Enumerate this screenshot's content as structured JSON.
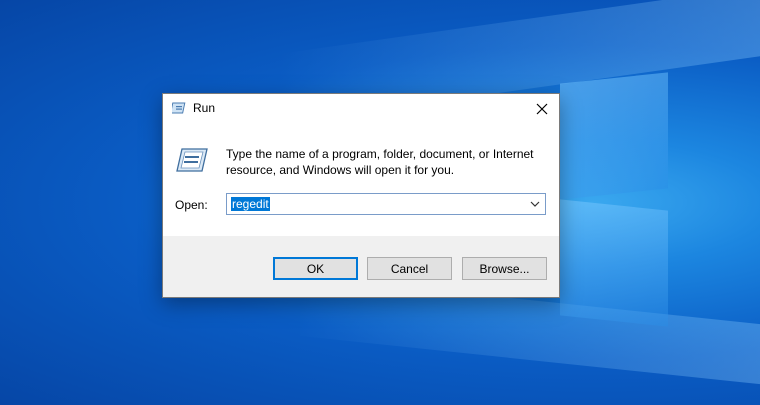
{
  "dialog": {
    "title": "Run",
    "description": "Type the name of a program, folder, document, or Internet resource, and Windows will open it for you.",
    "open_label": "Open:",
    "open_value": "regedit",
    "buttons": {
      "ok": "OK",
      "cancel": "Cancel",
      "browse": "Browse..."
    }
  },
  "icons": {
    "title": "run-icon",
    "close": "close-icon",
    "main": "run-icon",
    "dropdown": "chevron-down-icon"
  },
  "colors": {
    "desktop": "#0a5cc4",
    "selection": "#0078d7",
    "footer": "#f0f0f0"
  }
}
